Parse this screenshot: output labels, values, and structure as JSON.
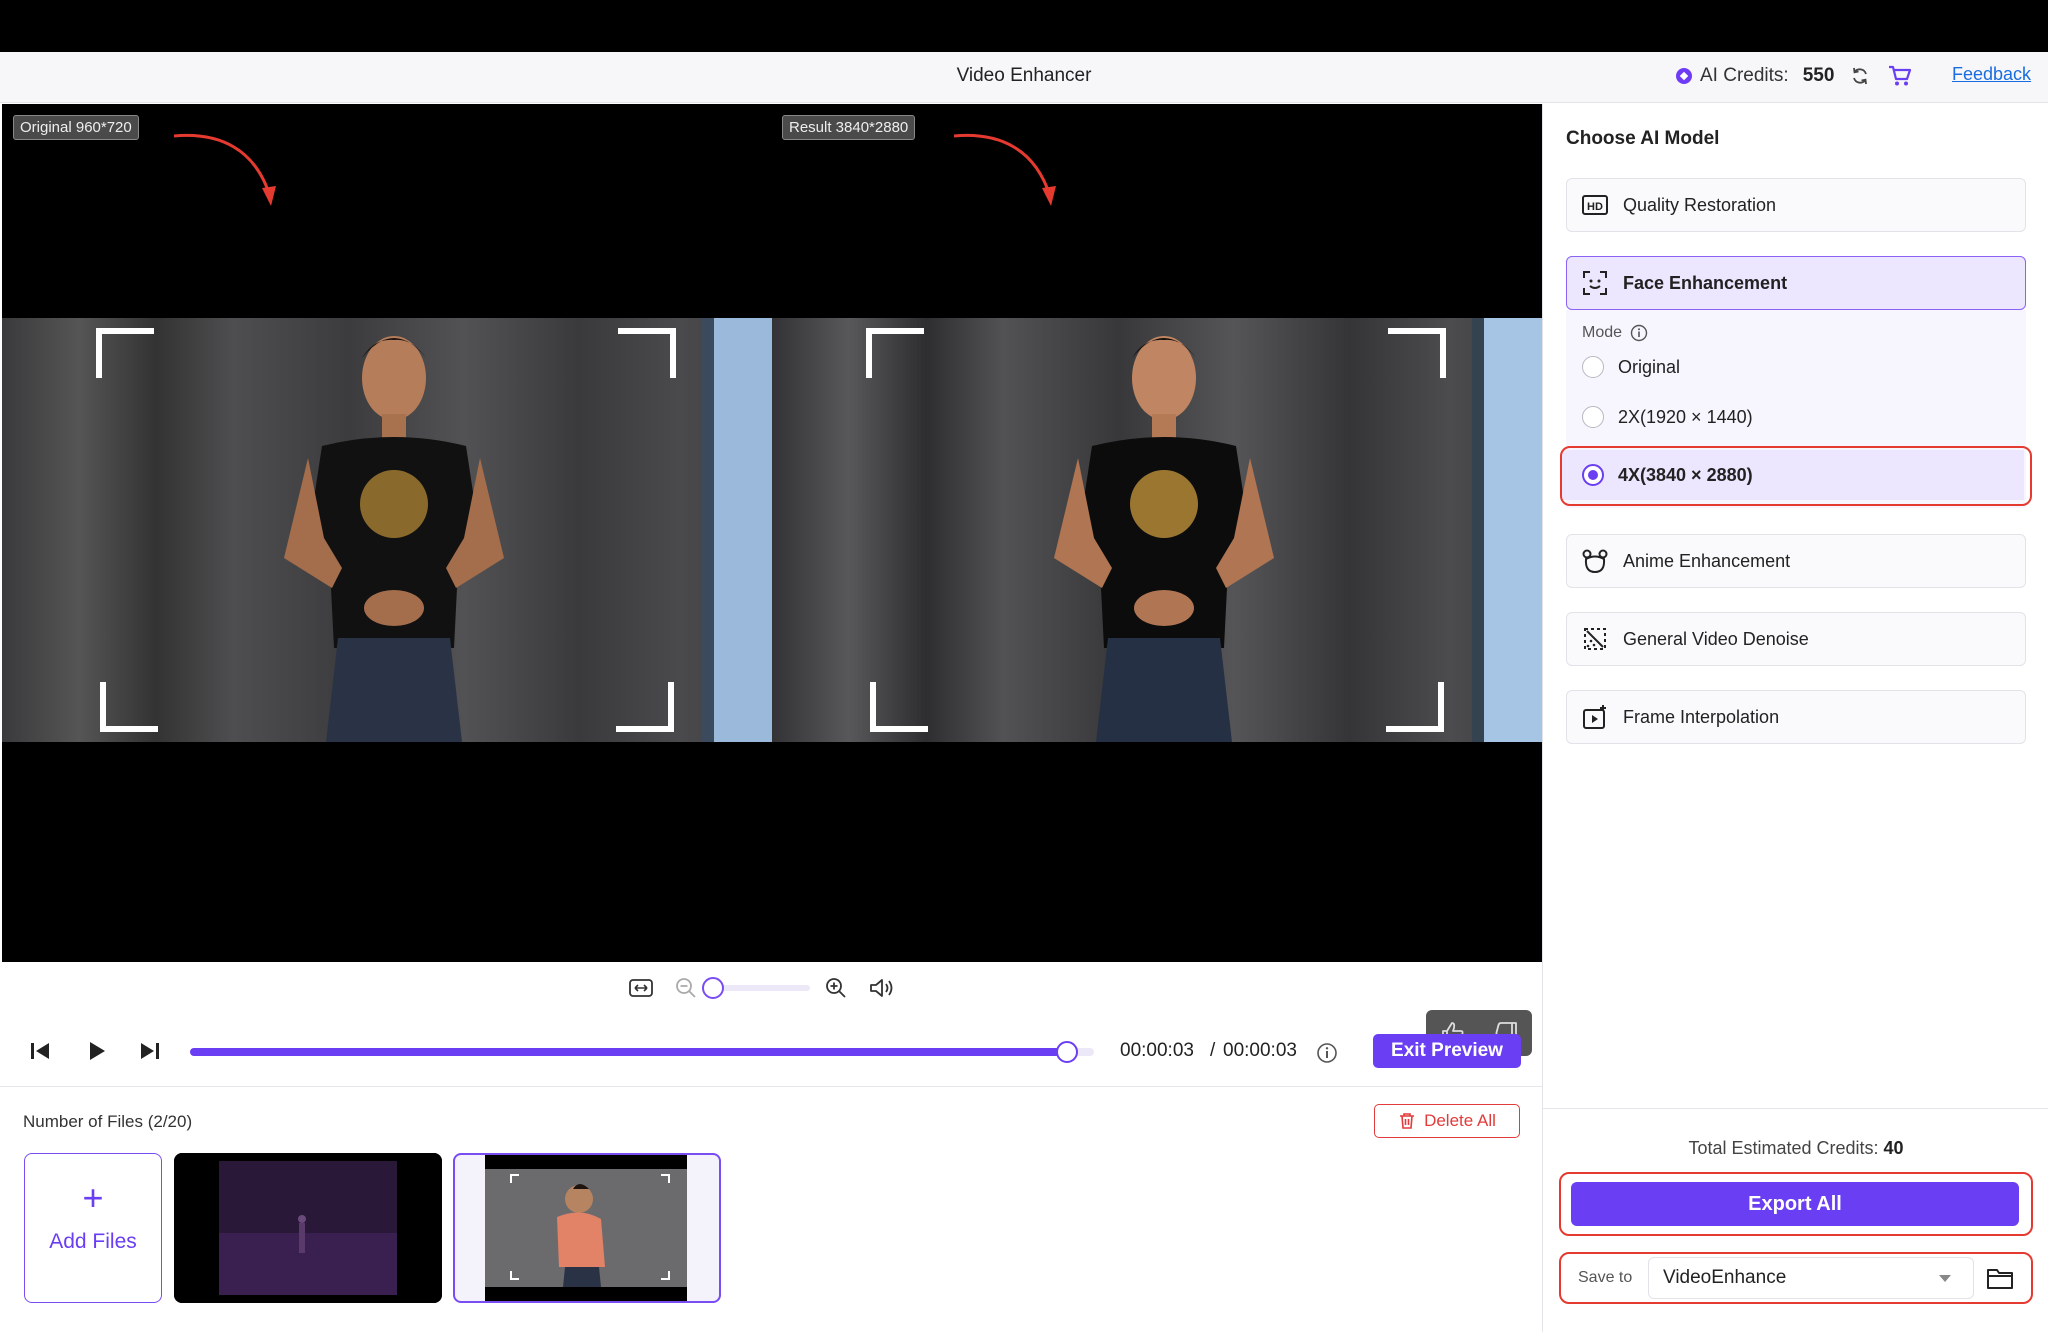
{
  "header": {
    "title": "Video Enhancer",
    "credits_label": "AI Credits:",
    "credits_value": "550",
    "feedback": "Feedback"
  },
  "preview": {
    "original_tag": "Original 960*720",
    "result_tag": "Result 3840*2880"
  },
  "transport": {
    "current_time": "00:00:03",
    "separator": "/",
    "total_time": "00:00:03",
    "progress": 0.97,
    "exit_preview": "Exit Preview"
  },
  "zoom": {
    "level": 0.0
  },
  "files": {
    "count_label": "Number of Files (2/20)",
    "delete_all": "Delete All",
    "add_plus": "+",
    "add_files": "Add Files"
  },
  "sidebar": {
    "title": "Choose AI Model",
    "models": [
      {
        "label": "Quality Restoration",
        "icon": "hd-icon"
      },
      {
        "label": "Face Enhancement",
        "icon": "face-scan-icon"
      },
      {
        "label": "Anime Enhancement",
        "icon": "anime-icon"
      },
      {
        "label": "General Video Denoise",
        "icon": "denoise-icon"
      },
      {
        "label": "Frame Interpolation",
        "icon": "frame-interpolation-icon"
      }
    ],
    "mode_label": "Mode",
    "modes": [
      "Original",
      "2X(1920 × 1440)",
      "4X(3840 × 2880)"
    ],
    "selected_mode": "4X(3840 × 2880)",
    "total_label": "Total Estimated Credits:",
    "total_value": "40",
    "export_all": "Export All",
    "save_to_label": "Save to",
    "save_to_value": "VideoEnhance"
  },
  "colors": {
    "accent": "#6a3ef2",
    "highlight": "#e53a2f",
    "danger": "#e23b3b"
  }
}
